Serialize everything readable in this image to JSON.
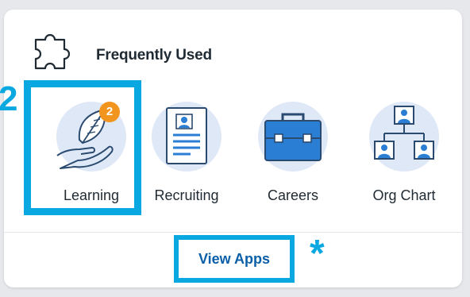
{
  "card": {
    "title": "Frequently Used"
  },
  "apps": [
    {
      "label": "Learning",
      "badge": "2"
    },
    {
      "label": "Recruiting"
    },
    {
      "label": "Careers"
    },
    {
      "label": "Org Chart"
    }
  ],
  "footer": {
    "view_apps_label": "View Apps"
  },
  "annotations": {
    "step": "2",
    "marker": "*"
  },
  "colors": {
    "accent": "#0aa8e0",
    "badge": "#f2951f",
    "link": "#0b5fa8",
    "icon_blue": "#2a7fd4",
    "icon_bg": "#dfe8f6"
  }
}
